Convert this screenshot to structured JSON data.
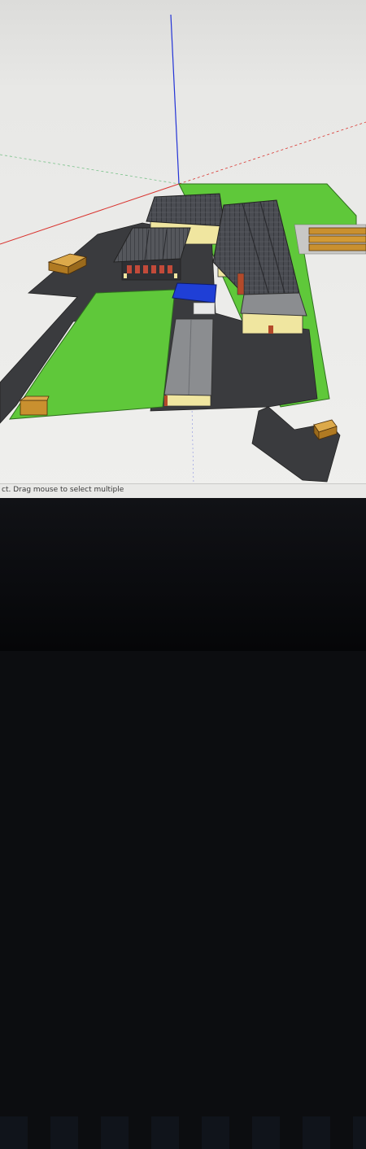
{
  "app": {
    "name": "3D modeling viewport",
    "statusbar": {
      "hint_text": "ct. Drag mouse to select multiple"
    }
  },
  "scene": {
    "description_items": [
      "green-lawn",
      "asphalt-yard",
      "sawtooth-roof-building",
      "open-shed-with-vehicles",
      "long-gray-roof-building",
      "blue-roof-block",
      "stacked-timber-boxes"
    ]
  },
  "colors": {
    "grass": "#5fc83a",
    "asphalt": "#3a3b3e",
    "wall": "#f0e6a0",
    "roof_dark": "#4a4c52",
    "roof_gray": "#8b8d90",
    "blue_block": "#1f3fd6",
    "timber": "#c9902f",
    "axis_red": "#d9342f",
    "axis_green": "#2ea84a",
    "axis_blue": "#2333d6"
  }
}
